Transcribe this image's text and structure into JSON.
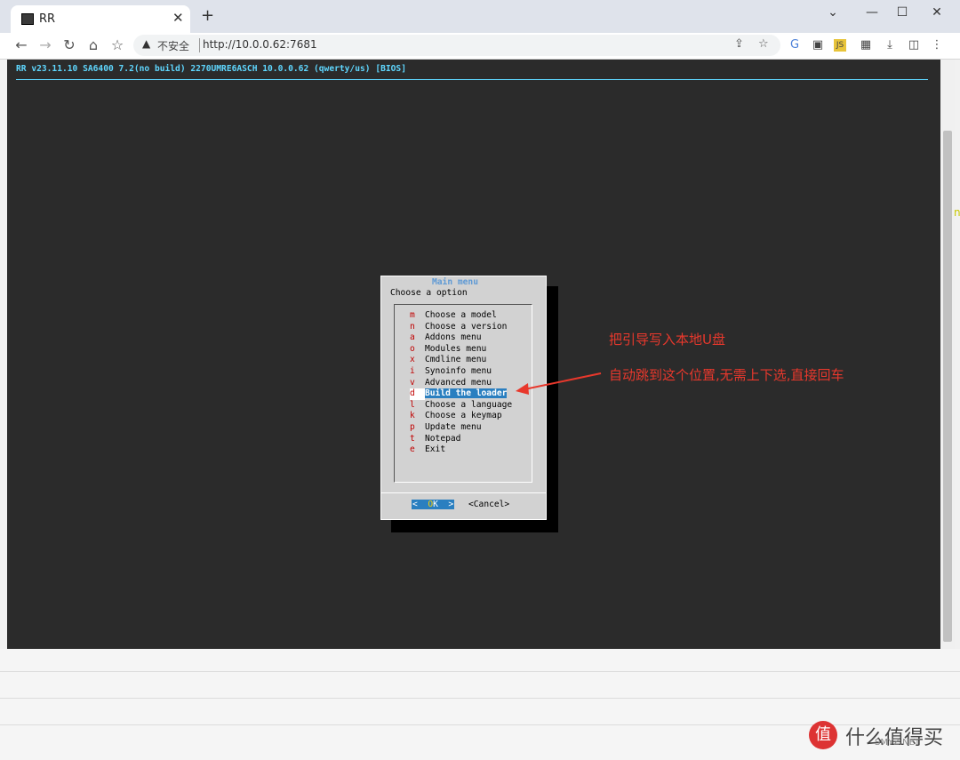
{
  "browser": {
    "tab_title": "RR",
    "tab_close": "✕",
    "new_tab": "+",
    "window_controls": [
      "⌄",
      "—",
      "☐",
      "✕"
    ],
    "nav": [
      "←",
      "→",
      "↻",
      "⌂",
      "☆"
    ],
    "security_label": "不安全",
    "url": "http://10.0.0.62:7681",
    "extension_icons": [
      "translate-icon",
      "mask-icon",
      "js-icon",
      "grid-icon",
      "download-icon",
      "sidebar-icon",
      "menu-icon"
    ],
    "extension_glyphs": [
      "G",
      "▣",
      "JS",
      "▦",
      "⤓",
      "◫",
      "⋮"
    ]
  },
  "terminal": {
    "status_line": "RR v23.11.10 SA6400 7.2(no build) 2270UMRE6ASCH 10.0.0.62 (qwerty/us) [BIOS]",
    "edge_glyph": "n"
  },
  "dialog": {
    "title": "Main menu",
    "prompt": "Choose a option",
    "items": [
      {
        "key": "m",
        "label": "Choose a model"
      },
      {
        "key": "n",
        "label": "Choose a version"
      },
      {
        "key": "a",
        "label": "Addons menu"
      },
      {
        "key": "o",
        "label": "Modules menu"
      },
      {
        "key": "x",
        "label": "Cmdline menu"
      },
      {
        "key": "i",
        "label": "Synoinfo menu"
      },
      {
        "key": "v",
        "label": "Advanced menu"
      },
      {
        "key": "d",
        "label": "Build the loader"
      },
      {
        "key": "l",
        "label": "Choose a language"
      },
      {
        "key": "k",
        "label": "Choose a keymap"
      },
      {
        "key": "p",
        "label": "Update menu"
      },
      {
        "key": "t",
        "label": "Notepad"
      },
      {
        "key": "e",
        "label": "Exit"
      }
    ],
    "selected_index": 7,
    "ok_left": "<  ",
    "ok_o": "O",
    "ok_rest": "K  >",
    "cancel": "<Cancel>"
  },
  "annotations": {
    "line1": "把引导写入本地U盘",
    "line2": "自动跳到这个位置,无需上下选,直接回车",
    "color": "#e8382c"
  },
  "watermark": {
    "badge": "值",
    "text": "什么值得买",
    "sub": "SMYZ.NET"
  }
}
